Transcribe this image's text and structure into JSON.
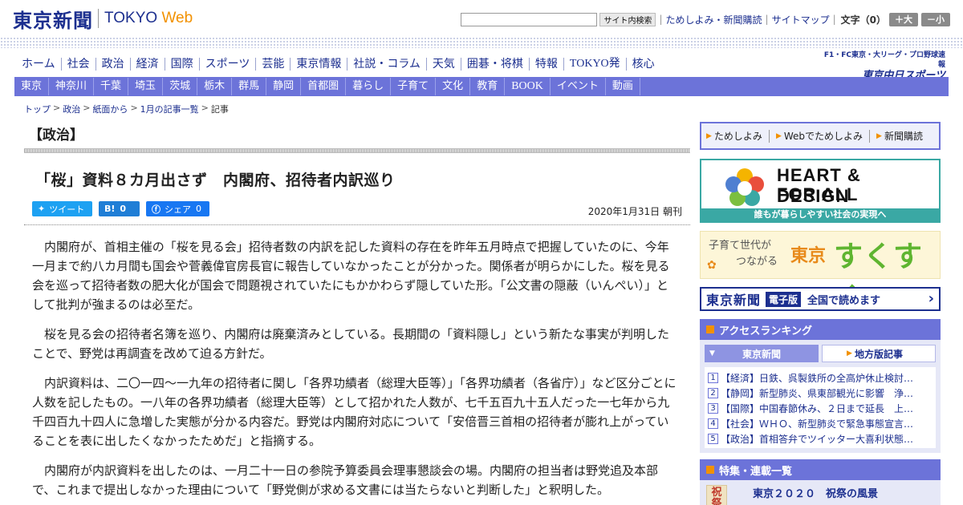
{
  "header": {
    "logo_jp": "東京新聞",
    "logo_en_main": "TOKYO ",
    "logo_en_web": "Web",
    "search_placeholder": "",
    "search_button": "サイト内検索",
    "links": [
      "ためしよみ・新聞購読",
      "サイトマップ"
    ],
    "font_size_label": "文字（0）",
    "zoom_in": "＋大",
    "zoom_out": "－小"
  },
  "main_nav": [
    "ホーム",
    "社会",
    "政治",
    "経済",
    "国際",
    "スポーツ",
    "芸能",
    "東京情報",
    "社説・コラム",
    "天気",
    "囲碁・将棋",
    "特報",
    "TOKYO発",
    "核心"
  ],
  "chunichi": {
    "line1": "F1・FC東京・大リーグ・プロ野球速報",
    "line2": "東京中日スポーツ"
  },
  "sub_nav": [
    "東京",
    "神奈川",
    "千葉",
    "埼玉",
    "茨城",
    "栃木",
    "群馬",
    "静岡",
    "首都圏",
    "暮らし",
    "子育て",
    "文化",
    "教育",
    "BOOK",
    "イベント",
    "動画"
  ],
  "breadcrumb": [
    "トップ",
    "政治",
    "紙面から",
    "1月の記事一覧",
    "記事"
  ],
  "article": {
    "section": "【政治】",
    "headline": "「桜」資料８カ月出さず　内閣府、招待者内訳巡り",
    "share": {
      "tweet_label": "ツイート",
      "hatena_label": "B!",
      "hatena_count": "0",
      "facebook_label": "シェア",
      "facebook_count": "0"
    },
    "date": "2020年1月31日 朝刊",
    "paragraphs": [
      "内閣府が、首相主催の「桜を見る会」招待者数の内訳を記した資料の存在を昨年五月時点で把握していたのに、今年一月まで約八カ月間も国会や菅義偉官房長官に報告していなかったことが分かった。関係者が明らかにした。桜を見る会を巡って招待者数の肥大化が国会で問題視されていたにもかかわらず隠していた形。「公文書の隠蔽（いんぺい）」として批判が強まるのは必至だ。",
      "桜を見る会の招待者名簿を巡り、内閣府は廃棄済みとしている。長期間の「資料隠し」という新たな事実が判明したことで、野党は再調査を改めて迫る方針だ。",
      "内訳資料は、二〇一四～一九年の招待者に関し「各界功績者（総理大臣等）」「各界功績者（各省庁）」など区分ごとに人数を記したもの。一八年の各界功績者（総理大臣等）として招かれた人数が、七千五百九十五人だった一七年から九千四百九十四人に急増した実態が分かる内容だ。野党は内閣府対応について「安倍晋三首相の招待者が膨れ上がっていることを表に出したくなかったためだ」と指摘する。",
      "内閣府が内訳資料を出したのは、一月二十一日の参院予算委員会理事懇談会の場。内閣府の担当者は野党追及本部で、これまで提出しなかった理由について「野党側が求める文書には当たらないと判断した」と釈明した。"
    ]
  },
  "sidebar": {
    "links": [
      "ためしよみ",
      "Webでためしよみ",
      "新聞購読"
    ],
    "heart": {
      "line1": "HEART & DESIGN",
      "line2": "FOR ALL",
      "footer": "誰もが暮らしやすい社会の実現へ"
    },
    "sukusuku": {
      "line1": "子育て世代が",
      "line2": "つながる",
      "tokyo": "東京",
      "name": "すくすく"
    },
    "eban": {
      "logo": "東京新聞",
      "tag": "電子版",
      "text": "全国で読めます"
    },
    "ranking": {
      "title": "アクセスランキング",
      "tab_active": "東京新聞",
      "tab_inactive": "地方版記事",
      "items": [
        {
          "num": "1",
          "text": "【経済】日鉄、呉製鉄所の全高炉休止検討…"
        },
        {
          "num": "2",
          "text": "【静岡】新型肺炎、県東部観光に影響　浄…"
        },
        {
          "num": "3",
          "text": "【国際】中国春節休み、２日まで延長　上…"
        },
        {
          "num": "4",
          "text": "【社会】ＷＨＯ、新型肺炎で緊急事態宣言…"
        },
        {
          "num": "5",
          "text": "【政治】首相答弁でツイッター大喜利状態…"
        }
      ]
    },
    "tokushu": {
      "title": "特集・連載一覧",
      "thumb": "祝祭",
      "item_title": "東京２０２０　祝祭の風景"
    }
  }
}
